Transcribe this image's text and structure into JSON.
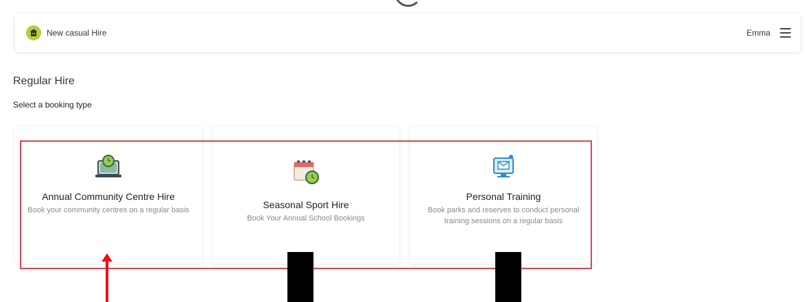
{
  "topbar": {
    "brand_label": "New casual Hire",
    "user_name": "Emma"
  },
  "page": {
    "title": "Regular Hire",
    "subtitle": "Select a booking type"
  },
  "cards": [
    {
      "title": "Annual Community Centre Hire",
      "description": "Book your community centres on a regular basis",
      "icon": "laptop-clock-icon"
    },
    {
      "title": "Seasonal Sport Hire",
      "description": "Book Your Annual School Bookings",
      "icon": "calendar-clock-icon"
    },
    {
      "title": "Personal Training",
      "description": "Book parks and reserves to conduct personal training sessions on a regular basis",
      "icon": "monitor-mail-icon"
    }
  ],
  "annotations": {
    "highlight_color": "#e04050",
    "arrow_color": "#e8101a"
  }
}
